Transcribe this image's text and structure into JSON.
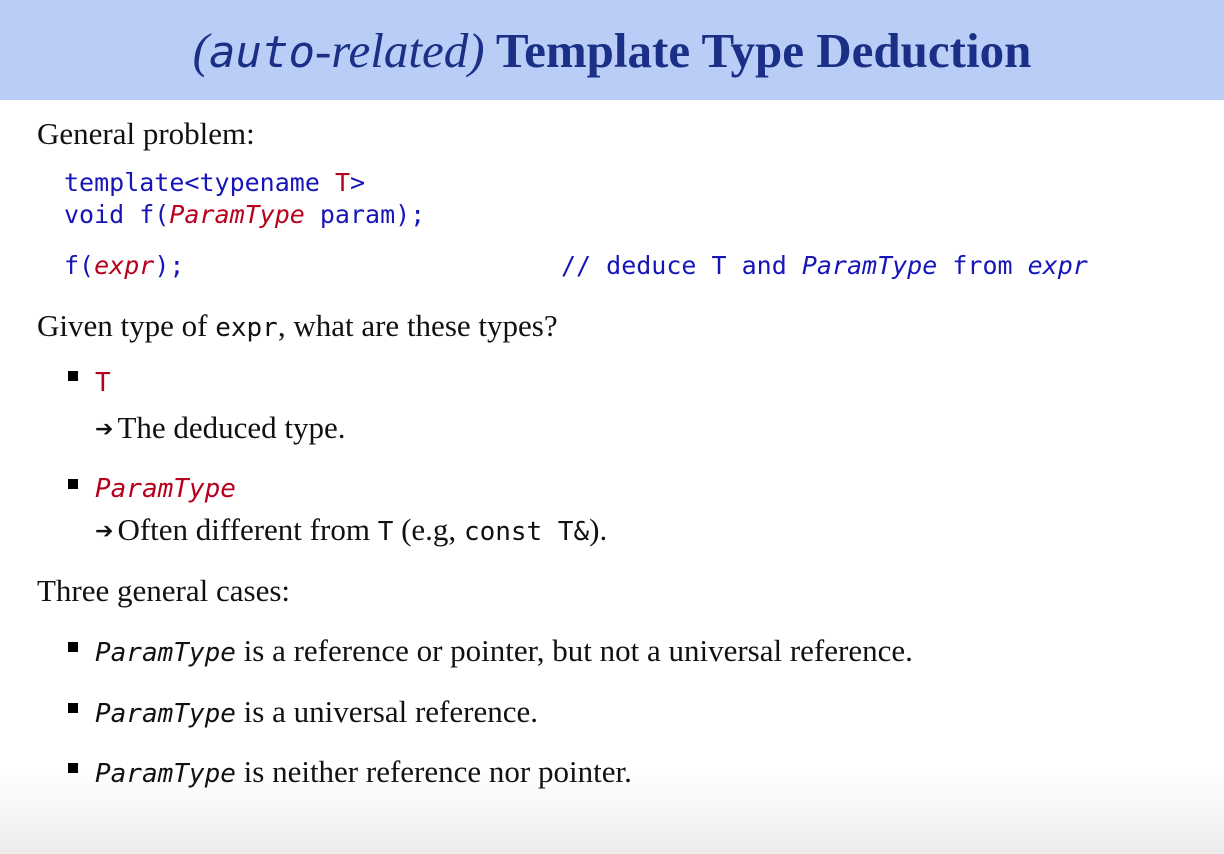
{
  "title": {
    "paren_open": "(",
    "auto": "auto",
    "related": "-related)",
    "rest": " Template Type Deduction"
  },
  "general_problem": "General problem:",
  "code": {
    "line1_kw": "template<typename ",
    "line1_T": "T",
    "line1_end": ">",
    "line2_a": "void f(",
    "line2_param_type": "ParamType",
    "line2_b": " param);",
    "line3_a": "f(",
    "line3_expr": "expr",
    "line3_b": ");",
    "comment_a": "// deduce T and ",
    "comment_param_type": "ParamType",
    "comment_b": " from ",
    "comment_expr": "expr"
  },
  "given": {
    "a": "Given type of ",
    "expr": "expr",
    "b": ", what are these types?"
  },
  "bullets": [
    {
      "label": "T",
      "sub": "The deduced type."
    },
    {
      "label": "ParamType",
      "sub_a": "Often different from ",
      "sub_T": "T",
      "sub_b": " (e.g, ",
      "sub_code": "const T&",
      "sub_c": ")."
    }
  ],
  "three_cases": "Three general cases:",
  "cases": [
    {
      "term": "ParamType",
      "text": " is a reference or pointer, but not a universal reference."
    },
    {
      "term": "ParamType",
      "text": " is a universal reference."
    },
    {
      "term": "ParamType",
      "text": " is neither reference nor pointer."
    }
  ]
}
